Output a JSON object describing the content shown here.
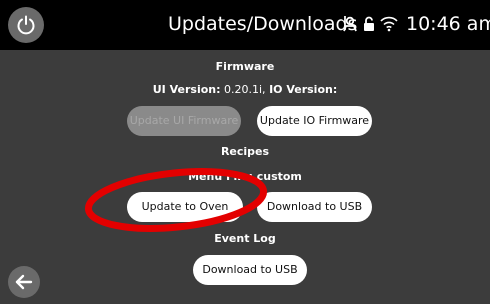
{
  "header": {
    "title": "Updates/Downloads",
    "time": "10:46 am",
    "icons": [
      "power-icon",
      "user-icon",
      "lock-icon",
      "wifi-icon"
    ]
  },
  "firmware": {
    "heading": "Firmware",
    "ui_version_label": "UI Version:",
    "ui_version_value": "0.20.1i,",
    "io_version_label": "IO Version:",
    "update_ui_label": "Update UI Firmware",
    "update_io_label": "Update IO Firmware"
  },
  "recipes": {
    "heading": "Recipes",
    "subheading": "Menu File: custom",
    "update_oven_label": "Update to Oven",
    "download_usb_label": "Download to USB"
  },
  "event_log": {
    "heading": "Event Log",
    "download_usb_label": "Download to USB"
  },
  "nav": {
    "back_icon": "arrow-left-icon"
  },
  "colors": {
    "background": "#3c3c3c",
    "topbar": "#000000",
    "button": "#ffffff",
    "button_disabled": "#8a8a8a",
    "annotation": "#e30000"
  }
}
